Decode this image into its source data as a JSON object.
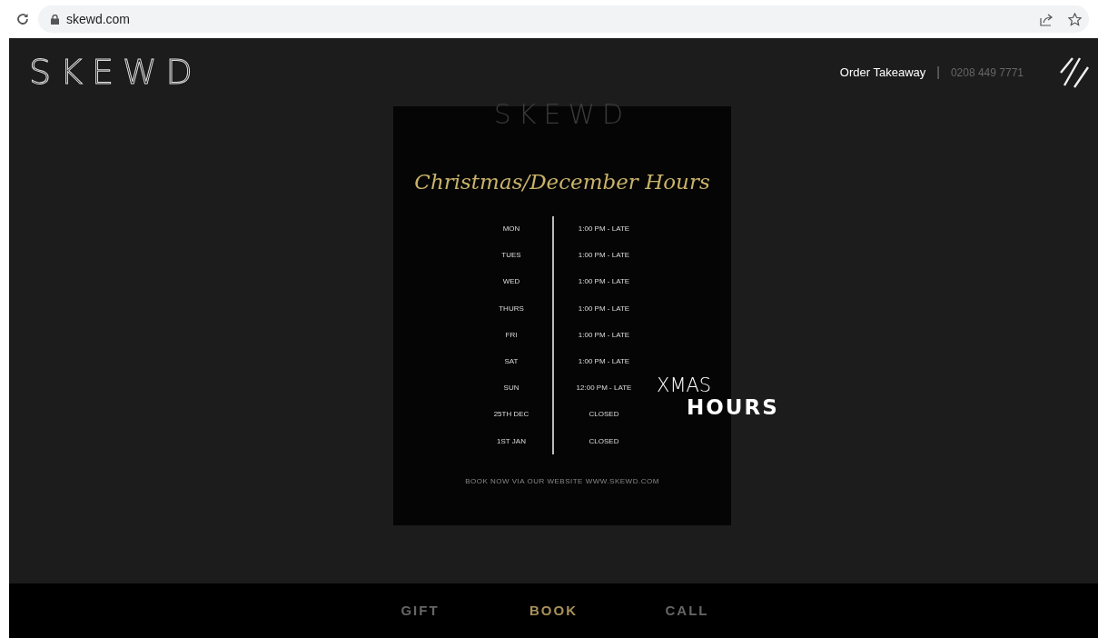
{
  "browser": {
    "url": "skewd.com"
  },
  "header": {
    "logo": "SKEWD",
    "order_link": "Order Takeaway",
    "separator": "|",
    "phone": "0208 449 7771"
  },
  "poster": {
    "logo": "SKEWD",
    "title": "Christmas/December Hours",
    "hours": [
      {
        "day": "MON",
        "time": "1:00 PM - LATE"
      },
      {
        "day": "TUES",
        "time": "1:00 PM - LATE"
      },
      {
        "day": "WED",
        "time": "1:00 PM - LATE"
      },
      {
        "day": "THURS",
        "time": "1:00 PM - LATE"
      },
      {
        "day": "FRI",
        "time": "1:00 PM - LATE"
      },
      {
        "day": "SAT",
        "time": "1:00 PM - LATE"
      },
      {
        "day": "SUN",
        "time": "12:00 PM - LATE"
      },
      {
        "day": "25TH DEC",
        "time": "CLOSED"
      },
      {
        "day": "1ST JAN",
        "time": "CLOSED"
      }
    ],
    "footer": "BOOK NOW VIA OUR WEBSITE WWW.SKEWD.COM"
  },
  "overlay": {
    "line1": "XMAS",
    "line2": "HOURS"
  },
  "bottom_nav": [
    {
      "label": "GIFT",
      "selected": false
    },
    {
      "label": "BOOK",
      "selected": true
    },
    {
      "label": "CALL",
      "selected": false
    }
  ]
}
